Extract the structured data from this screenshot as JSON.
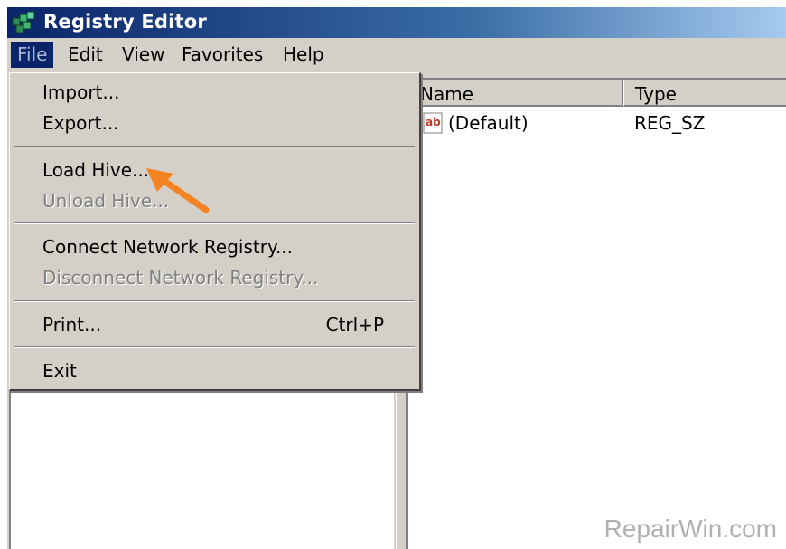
{
  "window": {
    "title": "Registry Editor"
  },
  "menubar": {
    "items": [
      "File",
      "Edit",
      "View",
      "Favorites",
      "Help"
    ]
  },
  "file_menu": {
    "import": "Import...",
    "export": "Export...",
    "load_hive": "Load Hive...",
    "unload_hive": "Unload Hive...",
    "connect_network_registry": "Connect Network Registry...",
    "disconnect_network_registry": "Disconnect Network Registry...",
    "print": "Print...",
    "print_shortcut": "Ctrl+P",
    "exit": "Exit"
  },
  "list": {
    "headers": {
      "name": "Name",
      "type": "Type"
    },
    "rows": [
      {
        "name": "(Default)",
        "type": "REG_SZ",
        "icon": "string-value-icon"
      }
    ]
  },
  "watermark": "RepairWin.com",
  "colors": {
    "accent_arrow": "#f58220",
    "menu_highlight": "#0a246a",
    "title_gradient_start": "#0a246a"
  }
}
